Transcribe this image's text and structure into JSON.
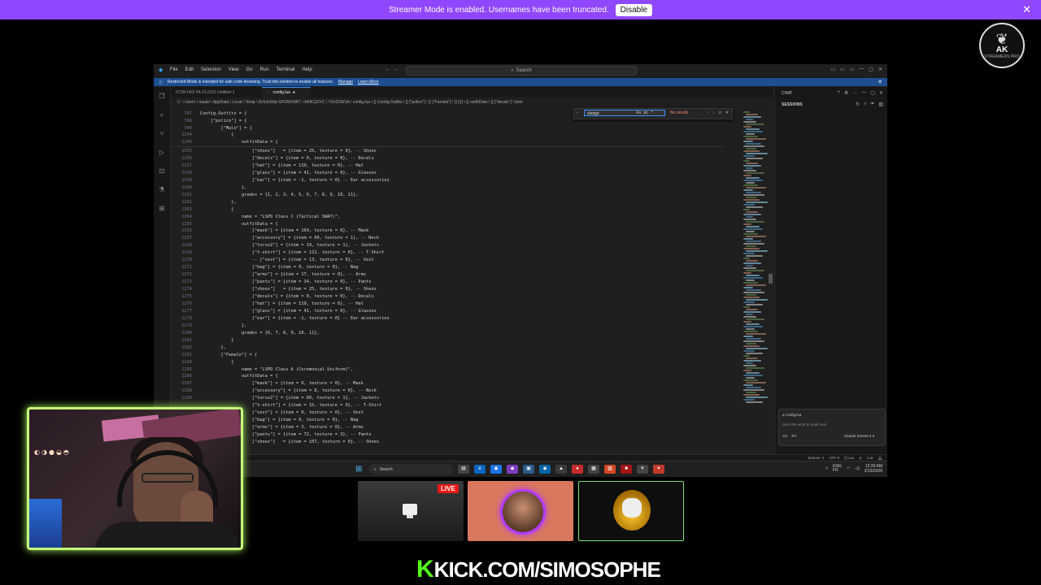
{
  "banner": {
    "text": "Streamer Mode is enabled. Usernames have been truncated.",
    "button": "Disable",
    "close": "✕"
  },
  "channel_logo": {
    "text": "AK",
    "sub": "STREAMERS PRO"
  },
  "vscode": {
    "menu": [
      "File",
      "Edit",
      "Selection",
      "View",
      "Go",
      "Run",
      "Terminal",
      "Help"
    ],
    "search_label": "Search",
    "restricted_text": "Restricted Mode is intended for safe code browsing. Trust this window to enable all features.",
    "restricted_manage": "Manage",
    "restricted_learn": "Learn More",
    "tabs": [
      {
        "label": "ICON FAS FA-CLOCK Untitled-1",
        "active": false
      },
      {
        "label": "config.lua",
        "active": true,
        "dirty": "●"
      }
    ],
    "breadcrumb": "C: \\ Users \\ maalo \\ AppData \\ Local \\ Temp \\ 8vSshSftp-GFDWX9R7 \\ 8AIKQXVC \\ Y3L0OW1A \\ config.lua \\ {} Config.Outfits \\ {} [\"police\"] \\ {} [\"Female\"] \\ {} [1] \\ {} outfitData \\ {} [\"decals\"] \\ item",
    "find": {
      "value": "sledge",
      "result": "No results",
      "opts": [
        "Aa",
        "ab",
        ".*"
      ],
      "nav": [
        "↑",
        "↓",
        "≡",
        "✕"
      ]
    },
    "sticky_lines": [
      {
        "n": "747",
        "t": "Config.Outfits = {"
      },
      {
        "n": "748",
        "t": "    [\"police\"] = {"
      },
      {
        "n": "749",
        "t": "        [\"Male\"] = {"
      },
      {
        "n": "1244",
        "t": "            {"
      },
      {
        "n": "1246",
        "t": "                outfitData = {"
      }
    ],
    "code_lines": [
      {
        "n": "1255",
        "t": "                    [\"shoes\"]   = {item = 25, texture = 0}, -- Shoes"
      },
      {
        "n": "1256",
        "t": "                    [\"decals\"] = {item = 0, texture = 0}, -- Decals"
      },
      {
        "n": "1257",
        "t": "                    [\"hat\"] = {item = 119, texture = 0}, -- Hat"
      },
      {
        "n": "1258",
        "t": "                    [\"glass\"] = {item = 41, texture = 0}, -- Glasses"
      },
      {
        "n": "1259",
        "t": "                    [\"ear\"] = {item = -1, texture = 0} -- Ear accessories"
      },
      {
        "n": "1260",
        "t": "                },"
      },
      {
        "n": "1261",
        "t": "                grades = {1, 2, 3, 4, 5, 6, 7, 8, 9, 10, 11},"
      },
      {
        "n": "1262",
        "t": "            },"
      },
      {
        "n": "1263",
        "t": "            {"
      },
      {
        "n": "1264",
        "t": "                name = \"LSPD Class C (Tactical SWAT)\","
      },
      {
        "n": "1265",
        "t": "                outfitData = {"
      },
      {
        "n": "1266",
        "t": "                    [\"mask\"] = {item = 169, texture = 0}, -- Mask"
      },
      {
        "n": "1267",
        "t": "                    [\"accessory\"] = {item = 60, texture = 1}, -- Neck"
      },
      {
        "n": "1268",
        "t": "                    [\"torso2\"] = {item = 19, texture = 1}, -- Jackets"
      },
      {
        "n": "1269",
        "t": "                    [\"t-shirt\"] = {item = 122, texture = 0}, -- T-Shirt"
      },
      {
        "n": "1270",
        "t": "                    -- [\"vest\"] = {item = 13, texture = 0}, -- Vest"
      },
      {
        "n": "1271",
        "t": "                    [\"bag\"] = {item = 0, texture = 0}, -- Bag"
      },
      {
        "n": "1272",
        "t": "                    [\"arms\"] = {item = 17, texture = 0}, -- Arms"
      },
      {
        "n": "1273",
        "t": "                    [\"pants\"] = {item = 34, texture = 0}, -- Pants"
      },
      {
        "n": "1274",
        "t": "                    [\"shoes\"]   = {item = 25, texture = 0}, -- Shoes"
      },
      {
        "n": "1275",
        "t": "                    [\"decals\"] = {item = 0, texture = 0}, -- Decals"
      },
      {
        "n": "1276",
        "t": "                    [\"hat\"] = {item = 119, texture = 0}, -- Hat"
      },
      {
        "n": "1277",
        "t": "                    [\"glass\"] = {item = 41, texture = 0}, -- Glasses"
      },
      {
        "n": "1278",
        "t": "                    [\"ear\"] = {item = -1, texture = 0} -- Ear accessories"
      },
      {
        "n": "1279",
        "t": "                },"
      },
      {
        "n": "1280",
        "t": "                grades = {6, 7, 8, 9, 10, 11},"
      },
      {
        "n": "1281",
        "t": "            }"
      },
      {
        "n": "1282",
        "t": "        },"
      },
      {
        "n": "1283",
        "t": "        [\"Female\"] = {"
      },
      {
        "n": "1284",
        "t": "            {"
      },
      {
        "n": "1285",
        "t": "                name = \"LSPD Class A (Ceremonial Uniform)\","
      },
      {
        "n": "1286",
        "t": "                outfitData = {"
      },
      {
        "n": "1287",
        "t": "                    [\"mask\"] = {item = 0, texture = 0}, -- Mask"
      },
      {
        "n": "1288",
        "t": "                    [\"accessory\"] = {item = 8, texture = 0}, -- Neck"
      },
      {
        "n": "1289",
        "t": "                    [\"torso2\"] = {item = 89, texture = 1}, -- Jackets"
      },
      {
        "n": "",
        "t": "                    [\"t-shirt\"] = {item = 15, texture = 0}, -- T-Shirt"
      },
      {
        "n": "",
        "t": "                    [\"vest\"] = {item = 0, texture = 0}, -- Vest"
      },
      {
        "n": "",
        "t": "                    [\"bag\"] = {item = 0, texture = 0}, -- Bag"
      },
      {
        "n": "",
        "t": "                    [\"arms\"] = {item = 3, texture = 0}, -- Arms"
      },
      {
        "n": "",
        "t": "                    [\"pants\"] = {item = 72, texture = 3}, -- Pants"
      },
      {
        "n": "",
        "t": "                    [\"shoes\"]   = {item = 107, texture = 0}, -- Shoes"
      }
    ],
    "chat": {
      "title": "CHAT",
      "sessions": "SESSIONS",
      "chip": "config.lua",
      "placeholder": "Describe what to build next",
      "model": "Claude Sonnet 4 ▾"
    },
    "status": {
      "spaces": "Spaces: 4",
      "encoding": "UTF-8",
      "eol": "{} Lua",
      "lang": "Lua"
    },
    "taskbar": {
      "search": "Search",
      "lang": "ENG\nFR",
      "time": "12:39 AM",
      "date": "2/15/2026"
    }
  },
  "stream": {
    "live_badge": "LIVE",
    "kick_url": "KICK.COM/SIMOSOPHE"
  },
  "colors": {
    "banner": "#9146ff",
    "kick_green": "#53fc18",
    "vscode_blue": "#3794ff",
    "webcam_border": "#c6f87d"
  }
}
